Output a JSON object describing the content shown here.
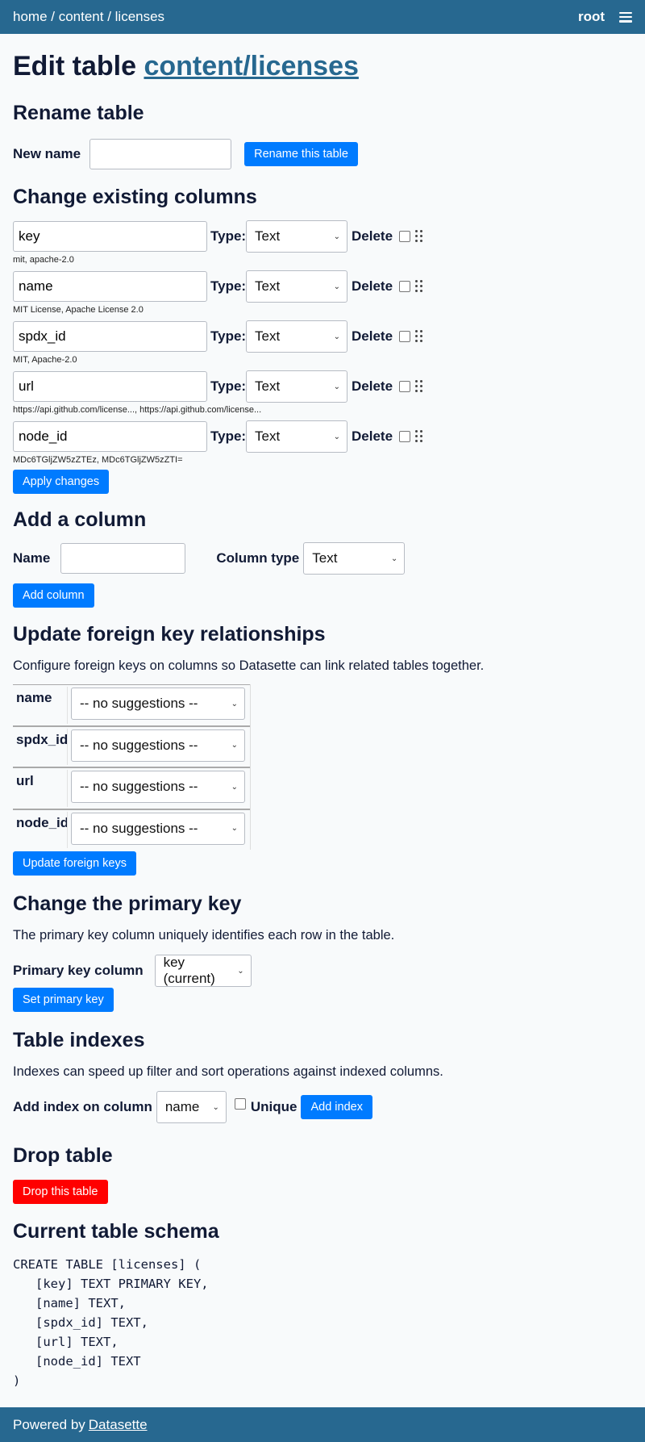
{
  "header": {
    "crumbs": {
      "home": "home",
      "sep1": " / ",
      "content": "content",
      "sep2": " / ",
      "licenses": "licenses"
    },
    "user": "root",
    "menu_icon": "hamburger-menu-icon"
  },
  "page": {
    "title_prefix": "Edit table ",
    "title_link": "content/licenses"
  },
  "rename": {
    "heading": "Rename table",
    "label": "New name",
    "value": "",
    "button": "Rename this table"
  },
  "columns": {
    "heading": "Change existing columns",
    "type_label": "Type:",
    "delete_label": "Delete",
    "items": [
      {
        "name": "key",
        "type": "Text",
        "examples": "mit, apache-2.0"
      },
      {
        "name": "name",
        "type": "Text",
        "examples": "MIT License, Apache License 2.0"
      },
      {
        "name": "spdx_id",
        "type": "Text",
        "examples": "MIT, Apache-2.0"
      },
      {
        "name": "url",
        "type": "Text",
        "examples": "https://api.github.com/license..., https://api.github.com/license..."
      },
      {
        "name": "node_id",
        "type": "Text",
        "examples": "MDc6TGljZW5zZTEz, MDc6TGljZW5zZTI="
      }
    ],
    "apply_button": "Apply changes"
  },
  "add_column": {
    "heading": "Add a column",
    "name_label": "Name",
    "name_value": "",
    "type_label": "Column type",
    "type_value": "Text",
    "button": "Add column"
  },
  "foreign_keys": {
    "heading": "Update foreign key relationships",
    "description": "Configure foreign keys on columns so Datasette can link related tables together.",
    "rows": [
      {
        "column": "name",
        "selection": "-- no suggestions --"
      },
      {
        "column": "spdx_id",
        "selection": "-- no suggestions --"
      },
      {
        "column": "url",
        "selection": "-- no suggestions --"
      },
      {
        "column": "node_id",
        "selection": "-- no suggestions --"
      }
    ],
    "button": "Update foreign keys"
  },
  "primary_key": {
    "heading": "Change the primary key",
    "description": "The primary key column uniquely identifies each row in the table.",
    "label": "Primary key column",
    "value": "key (current)",
    "button": "Set primary key"
  },
  "indexes": {
    "heading": "Table indexes",
    "description": "Indexes can speed up filter and sort operations against indexed columns.",
    "label": "Add index on column",
    "value": "name",
    "unique_label": "Unique",
    "button": "Add index"
  },
  "drop": {
    "heading": "Drop table",
    "button": "Drop this table",
    "button_color": "#ff0000"
  },
  "schema": {
    "heading": "Current table schema",
    "sql": "CREATE TABLE [licenses] (\n   [key] TEXT PRIMARY KEY,\n   [name] TEXT,\n   [spdx_id] TEXT,\n   [url] TEXT,\n   [node_id] TEXT\n)"
  },
  "footer": {
    "prefix": "Powered by ",
    "link": "Datasette"
  },
  "colors": {
    "bar": "#276890",
    "button": "#007bff",
    "danger": "#ff0000",
    "background": "#f8fafb",
    "text": "#111a35"
  }
}
